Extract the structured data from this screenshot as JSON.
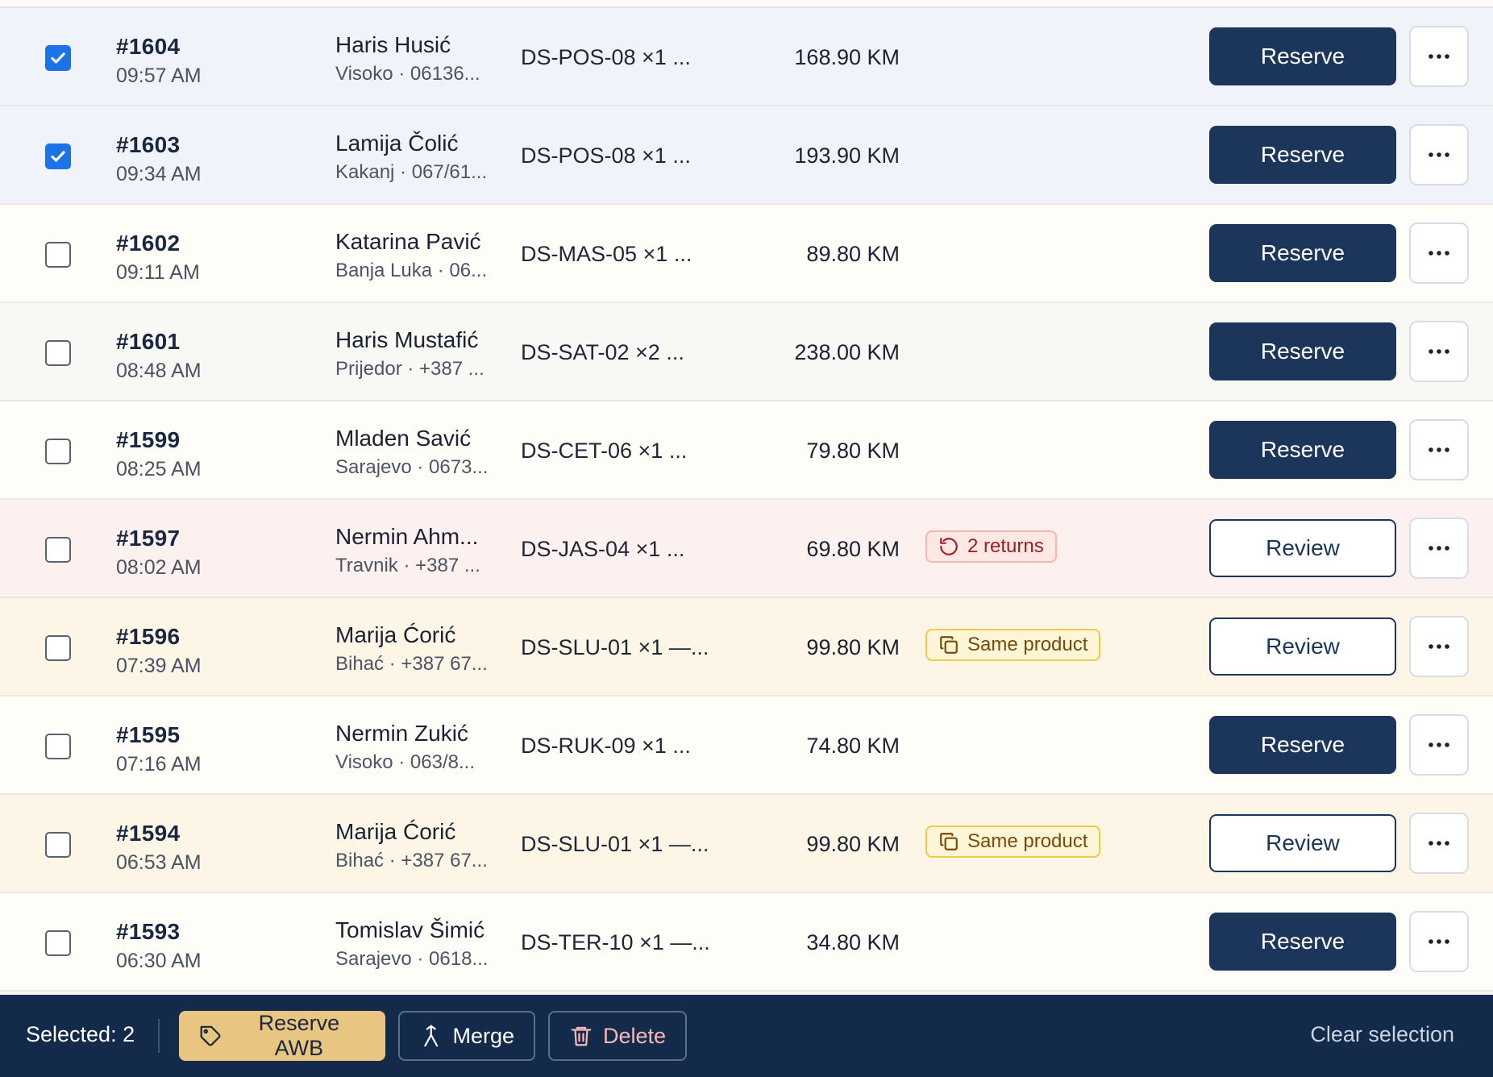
{
  "colors": {
    "primary": "#1c355a",
    "checkbox_checked": "#1b73e8",
    "bar_bg": "#142a4a",
    "awb_button": "#e8c682",
    "returns_badge": "#a31d1d",
    "same_product_badge": "#7a4a06"
  },
  "orders": [
    {
      "selected": true,
      "id": "#1604",
      "time": "09:57 AM",
      "name": "Haris Husić",
      "info": "Visoko · 06136...",
      "sku": "DS-POS-08 ×1 ...",
      "amount": "168.90 KM",
      "badge": null,
      "action": "Reserve",
      "action_style": "primary",
      "row_bg": "bg-selected"
    },
    {
      "selected": true,
      "id": "#1603",
      "time": "09:34 AM",
      "name": "Lamija Čolić",
      "info": "Kakanj · 067/61...",
      "sku": "DS-POS-08 ×1 ...",
      "amount": "193.90 KM",
      "badge": null,
      "action": "Reserve",
      "action_style": "primary",
      "row_bg": "bg-selected"
    },
    {
      "selected": false,
      "id": "#1602",
      "time": "09:11 AM",
      "name": "Katarina Pavić",
      "info": "Banja Luka · 06...",
      "sku": "DS-MAS-05 ×1 ...",
      "amount": "89.80 KM",
      "badge": null,
      "action": "Reserve",
      "action_style": "primary",
      "row_bg": "bg-cream"
    },
    {
      "selected": false,
      "id": "#1601",
      "time": "08:48 AM",
      "name": "Haris Mustafić",
      "info": "Prijedor · +387 ...",
      "sku": "DS-SAT-02 ×2 ...",
      "amount": "238.00 KM",
      "badge": null,
      "action": "Reserve",
      "action_style": "primary",
      "row_bg": "bg-plain"
    },
    {
      "selected": false,
      "id": "#1599",
      "time": "08:25 AM",
      "name": "Mladen Savić",
      "info": "Sarajevo · 0673...",
      "sku": "DS-CET-06 ×1 ...",
      "amount": "79.80 KM",
      "badge": null,
      "action": "Reserve",
      "action_style": "primary",
      "row_bg": "bg-cream"
    },
    {
      "selected": false,
      "id": "#1597",
      "time": "08:02 AM",
      "name": "Nermin Ahm...",
      "info": "Travnik · +387 ...",
      "sku": "DS-JAS-04 ×1 ...",
      "amount": "69.80 KM",
      "badge": {
        "type": "red",
        "icon": "rotate-ccw-icon",
        "text": "2 returns"
      },
      "action": "Review",
      "action_style": "outline",
      "row_bg": "bg-pink"
    },
    {
      "selected": false,
      "id": "#1596",
      "time": "07:39 AM",
      "name": "Marija Ćorić",
      "info": "Bihać · +387 67...",
      "sku": "DS-SLU-01 ×1 —...",
      "amount": "99.80 KM",
      "badge": {
        "type": "amber",
        "icon": "copy-icon",
        "text": "Same product"
      },
      "action": "Review",
      "action_style": "outline",
      "row_bg": "bg-peach"
    },
    {
      "selected": false,
      "id": "#1595",
      "time": "07:16 AM",
      "name": "Nermin Zukić",
      "info": "Visoko · 063/8...",
      "sku": "DS-RUK-09 ×1 ...",
      "amount": "74.80 KM",
      "badge": null,
      "action": "Reserve",
      "action_style": "primary",
      "row_bg": "bg-cream"
    },
    {
      "selected": false,
      "id": "#1594",
      "time": "06:53 AM",
      "name": "Marija Ćorić",
      "info": "Bihać · +387 67...",
      "sku": "DS-SLU-01 ×1 —...",
      "amount": "99.80 KM",
      "badge": {
        "type": "amber",
        "icon": "copy-icon",
        "text": "Same product"
      },
      "action": "Review",
      "action_style": "outline",
      "row_bg": "bg-peach"
    },
    {
      "selected": false,
      "id": "#1593",
      "time": "06:30 AM",
      "name": "Tomislav Šimić",
      "info": "Sarajevo · 0618...",
      "sku": "DS-TER-10 ×1 —...",
      "amount": "34.80 KM",
      "badge": null,
      "action": "Reserve",
      "action_style": "primary",
      "row_bg": "bg-cream"
    }
  ],
  "bottom_bar": {
    "selected_text": "Selected: 2",
    "reserve_awb": "Reserve AWB",
    "merge": "Merge",
    "delete": "Delete",
    "clear_selection": "Clear selection"
  }
}
